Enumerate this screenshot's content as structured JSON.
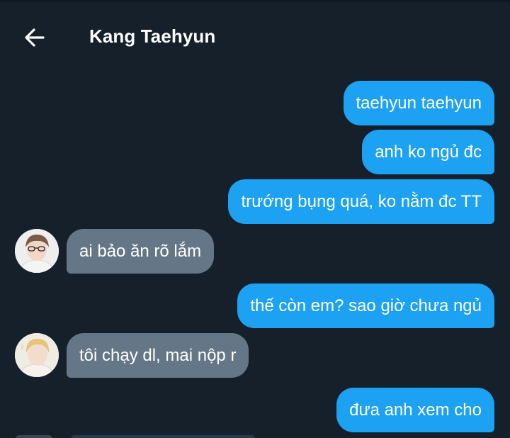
{
  "header": {
    "title": "Kang Taehyun",
    "back_icon": "arrow-left-icon"
  },
  "colors": {
    "background": "#15202b",
    "sent_bubble": "#1da1f2",
    "received_bubble": "#657786",
    "text": "#ffffff"
  },
  "messages": [
    {
      "from": "me",
      "text": "taehyun taehyun"
    },
    {
      "from": "me",
      "text": "anh ko ngủ đc"
    },
    {
      "from": "me",
      "text": "trướng bụng quá, ko nằm đc TT"
    },
    {
      "from": "them",
      "text": "ai bảo ăn rõ lắm"
    },
    {
      "from": "me",
      "text": "thế còn em? sao giờ chưa ngủ"
    },
    {
      "from": "them",
      "text": "tôi chạy dl, mai nộp r"
    },
    {
      "from": "me",
      "text": "đưa anh xem cho"
    }
  ]
}
